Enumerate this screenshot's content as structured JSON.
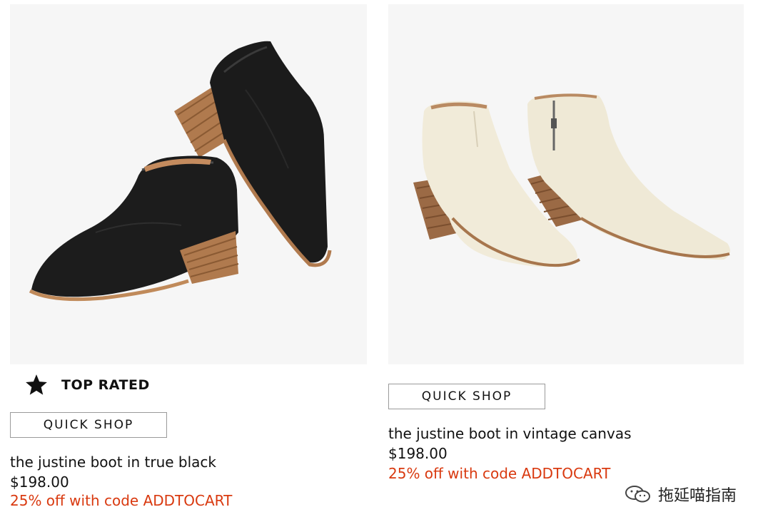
{
  "products": [
    {
      "name": "the justine boot in true black",
      "price": "$198.00",
      "promo": "25% off with code ADDTOCART",
      "quick_shop_label": "QUICK SHOP",
      "badge": {
        "label": "TOP RATED",
        "icon": "star-icon"
      },
      "image_icon": "black-ankle-boot-image",
      "boot_color": "#1a1a1a"
    },
    {
      "name": "the justine boot in vintage canvas",
      "price": "$198.00",
      "promo": "25% off with code ADDTOCART",
      "quick_shop_label": "QUICK SHOP",
      "image_icon": "cream-canvas-ankle-boot-image",
      "boot_color": "#efe9d6"
    }
  ],
  "watermark": {
    "text": "拖延喵指南",
    "icon": "wechat-icon"
  },
  "colors": {
    "promo": "#d9390f",
    "image_background": "#f6f6f6",
    "button_border": "#9a9a9a"
  }
}
